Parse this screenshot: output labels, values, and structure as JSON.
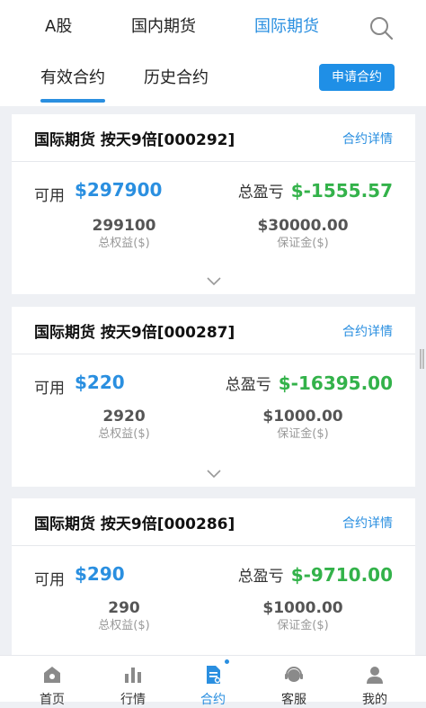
{
  "header": {
    "market_tabs": [
      {
        "label": "A股"
      },
      {
        "label": "国内期货"
      },
      {
        "label": "国际期货"
      }
    ],
    "active_market": "国际期货",
    "sub_tabs": [
      {
        "label": "有效合约"
      },
      {
        "label": "历史合约"
      }
    ],
    "apply_button": "申请合约"
  },
  "contracts": [
    {
      "title": "国际期货 按天9倍[000292]",
      "detail_link": "合约详情",
      "available_label": "可用",
      "available": "$297900",
      "pnl_label": "总盈亏",
      "pnl": "$-1555.57",
      "equity": "299100",
      "equity_label": "总权益($)",
      "margin": "$30000.00",
      "margin_label": "保证金($)"
    },
    {
      "title": "国际期货 按天9倍[000287]",
      "detail_link": "合约详情",
      "available_label": "可用",
      "available": "$220",
      "pnl_label": "总盈亏",
      "pnl": "$-16395.00",
      "equity": "2920",
      "equity_label": "总权益($)",
      "margin": "$1000.00",
      "margin_label": "保证金($)"
    },
    {
      "title": "国际期货 按天9倍[000286]",
      "detail_link": "合约详情",
      "available_label": "可用",
      "available": "$290",
      "pnl_label": "总盈亏",
      "pnl": "$-9710.00",
      "equity": "290",
      "equity_label": "总权益($)",
      "margin": "$1000.00",
      "margin_label": "保证金($)"
    }
  ],
  "bottom_nav": [
    {
      "label": "首页",
      "icon": "home-icon"
    },
    {
      "label": "行情",
      "icon": "chart-bars-icon"
    },
    {
      "label": "合约",
      "icon": "contract-doc-icon",
      "active": true
    },
    {
      "label": "客服",
      "icon": "headset-icon"
    },
    {
      "label": "我的",
      "icon": "user-icon"
    }
  ],
  "colors": {
    "accent": "#2a8fe0",
    "loss": "#33b24a",
    "background": "#eef0f4"
  }
}
